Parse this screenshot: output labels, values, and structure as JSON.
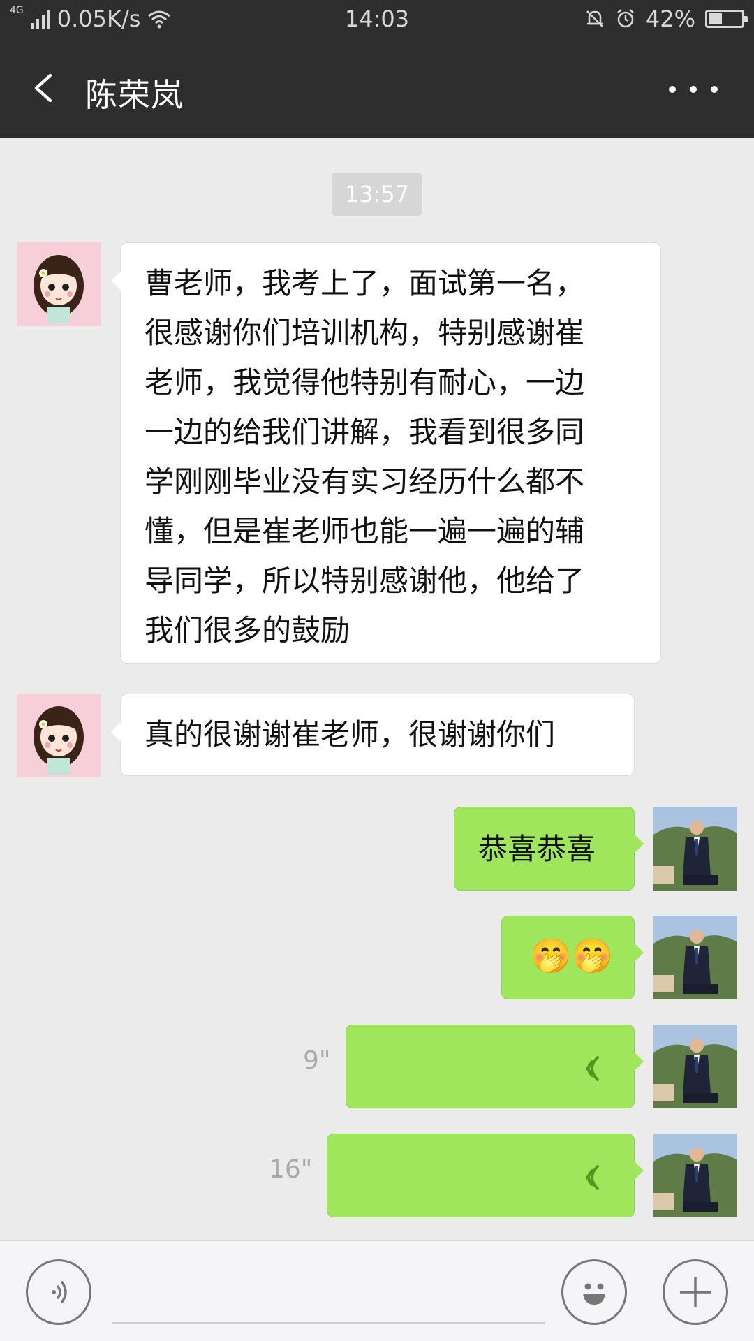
{
  "status_bar": {
    "network_type": "4G",
    "speed": "0.05K/s",
    "time": "14:03",
    "battery": "42%",
    "battery_level": 0.42
  },
  "header": {
    "title": "陈荣岚",
    "back_icon": "chevron-left-icon",
    "more_icon": "more-dots-icon"
  },
  "timestamp": "13:57",
  "messages": [
    {
      "side": "left",
      "type": "text",
      "lines": [
        "曹老师，我考上了，面试第一名，",
        "很感谢你们培训机构，特别感谢崔",
        "老师，我觉得他特别有耐心，一边",
        "一边的给我们讲解，我看到很多同",
        "学刚刚毕业没有实习经历什么都不",
        "懂，但是崔老师也能一遍一遍的辅",
        "导同学，所以特别感谢他，他给了",
        "我们很多的鼓励"
      ]
    },
    {
      "side": "left",
      "type": "text",
      "text": "真的很谢谢崔老师，很谢谢你们"
    },
    {
      "side": "right",
      "type": "text",
      "text": "恭喜恭喜"
    },
    {
      "side": "right",
      "type": "emoji",
      "text": "🤭🤭"
    },
    {
      "side": "right",
      "type": "voice",
      "duration": "9\""
    },
    {
      "side": "right",
      "type": "voice",
      "duration": "16\""
    }
  ],
  "input_bar": {
    "voice_icon": "voice-input-icon",
    "emoji_icon": "smiley-icon",
    "plus_icon": "plus-icon"
  },
  "colors": {
    "header_bg": "#2e2e2e",
    "chat_bg": "#ebebeb",
    "sent_bubble": "#9fe65c",
    "received_bubble": "#ffffff",
    "voice_wave": "#4f9a1e"
  }
}
